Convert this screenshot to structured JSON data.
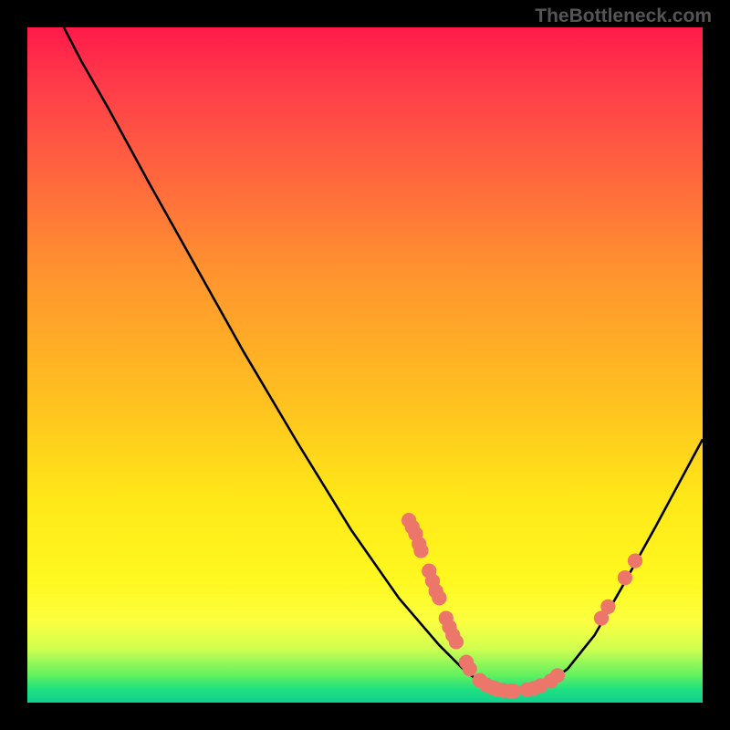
{
  "watermark": "TheBottleneck.com",
  "chart_data": {
    "type": "line",
    "title": "",
    "xlabel": "",
    "ylabel": "",
    "xlim": [
      0,
      100
    ],
    "ylim": [
      0,
      100
    ],
    "curve": [
      {
        "x": 5.4,
        "y": 100
      },
      {
        "x": 8,
        "y": 95
      },
      {
        "x": 12,
        "y": 88
      },
      {
        "x": 18,
        "y": 77
      },
      {
        "x": 25,
        "y": 64.5
      },
      {
        "x": 32,
        "y": 52
      },
      {
        "x": 40,
        "y": 38.5
      },
      {
        "x": 48,
        "y": 25.5
      },
      {
        "x": 55,
        "y": 15.5
      },
      {
        "x": 61,
        "y": 8.5
      },
      {
        "x": 65,
        "y": 4.5
      },
      {
        "x": 68,
        "y": 2.5
      },
      {
        "x": 71,
        "y": 1.8
      },
      {
        "x": 74,
        "y": 1.8
      },
      {
        "x": 77,
        "y": 2.8
      },
      {
        "x": 80,
        "y": 5
      },
      {
        "x": 84,
        "y": 10
      },
      {
        "x": 88,
        "y": 17
      },
      {
        "x": 93,
        "y": 26
      },
      {
        "x": 100,
        "y": 39
      }
    ],
    "markers": [
      {
        "x": 56.5,
        "y": 27
      },
      {
        "x": 57,
        "y": 26
      },
      {
        "x": 57.5,
        "y": 25
      },
      {
        "x": 58,
        "y": 23.5
      },
      {
        "x": 58.3,
        "y": 22.5
      },
      {
        "x": 59.5,
        "y": 19.5
      },
      {
        "x": 60,
        "y": 18
      },
      {
        "x": 60.5,
        "y": 16.5
      },
      {
        "x": 61,
        "y": 15.5
      },
      {
        "x": 62,
        "y": 12.5
      },
      {
        "x": 62.5,
        "y": 11.2
      },
      {
        "x": 63,
        "y": 10
      },
      {
        "x": 63.5,
        "y": 9
      },
      {
        "x": 65,
        "y": 6
      },
      {
        "x": 65.5,
        "y": 5
      },
      {
        "x": 67,
        "y": 3.3
      },
      {
        "x": 68,
        "y": 2.6
      },
      {
        "x": 69,
        "y": 2.2
      },
      {
        "x": 69.5,
        "y": 2
      },
      {
        "x": 70.5,
        "y": 1.8
      },
      {
        "x": 71.5,
        "y": 1.7
      },
      {
        "x": 72,
        "y": 1.7
      },
      {
        "x": 74,
        "y": 1.9
      },
      {
        "x": 75,
        "y": 2.1
      },
      {
        "x": 76,
        "y": 2.5
      },
      {
        "x": 77.5,
        "y": 3.2
      },
      {
        "x": 78.5,
        "y": 4
      },
      {
        "x": 85,
        "y": 12.5
      },
      {
        "x": 86,
        "y": 14.2
      },
      {
        "x": 88.5,
        "y": 18.5
      },
      {
        "x": 90,
        "y": 21
      }
    ],
    "marker_color": "#ed766b",
    "marker_radius": 1.1
  }
}
